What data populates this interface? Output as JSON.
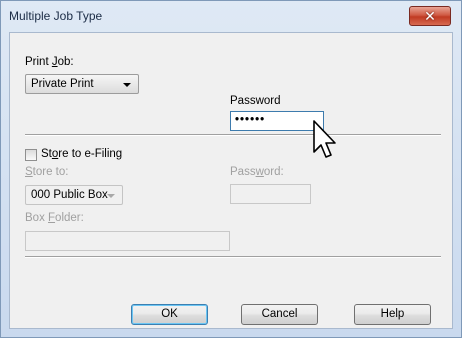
{
  "window": {
    "title": "Multiple Job Type",
    "close_glyph": "✕"
  },
  "print_job": {
    "label_pre": "Print ",
    "label_key": "J",
    "label_post": "ob:",
    "selected": "Private Print"
  },
  "password": {
    "label": "Password",
    "value": "••••••"
  },
  "store": {
    "checkbox_pre": "St",
    "checkbox_key": "o",
    "checkbox_post": "re to e-Filing",
    "checked": false,
    "store_to_pre": "",
    "store_to_key": "S",
    "store_to_post": "tore to:",
    "box_selected": "000 Public Box",
    "password_pre": "Pass",
    "password_key": "w",
    "password_post": "ord:",
    "box_folder_pre": "Box ",
    "box_folder_key": "F",
    "box_folder_post": "older:"
  },
  "buttons": {
    "ok": "OK",
    "cancel": "Cancel",
    "help": "Help"
  },
  "cursor": {
    "icon": "arrow-cursor"
  }
}
